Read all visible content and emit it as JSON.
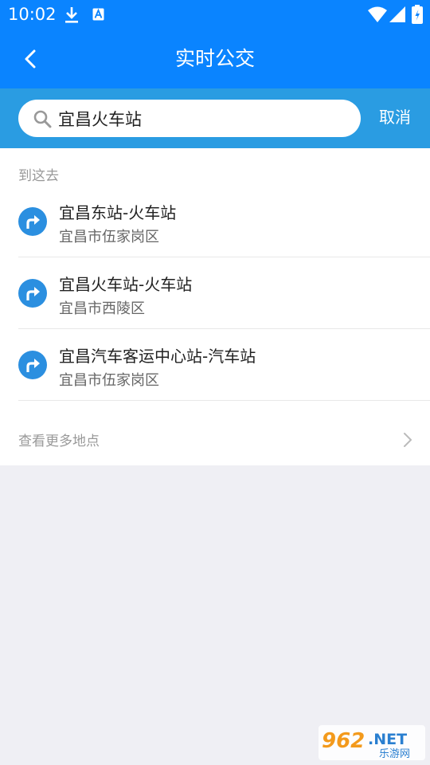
{
  "status_bar": {
    "time": "10:02",
    "icons": [
      "download-icon",
      "a-notification-icon",
      "wifi-icon",
      "signal-icon",
      "battery-icon"
    ]
  },
  "header": {
    "title": "实时公交",
    "back_icon": "back-arrow-icon"
  },
  "search": {
    "value": "宜昌火车站",
    "cancel_label": "取消"
  },
  "results": {
    "section_label": "到这去",
    "items": [
      {
        "name": "宜昌东站-火车站",
        "district": "宜昌市伍家岗区",
        "icon": "route-direction-icon"
      },
      {
        "name": "宜昌火车站-火车站",
        "district": "宜昌市西陵区",
        "icon": "route-direction-icon"
      },
      {
        "name": "宜昌汽车客运中心站-汽车站",
        "district": "宜昌市伍家岗区",
        "icon": "route-direction-icon"
      }
    ],
    "more_label": "查看更多地点"
  },
  "watermark": {
    "number": "962",
    "suffix": ".NET",
    "subtitle": "乐游网"
  },
  "colors": {
    "primary": "#0a84ff",
    "search_bar": "#2a9ce2",
    "icon_blue": "#2b8fe0",
    "background": "#efeff4"
  }
}
